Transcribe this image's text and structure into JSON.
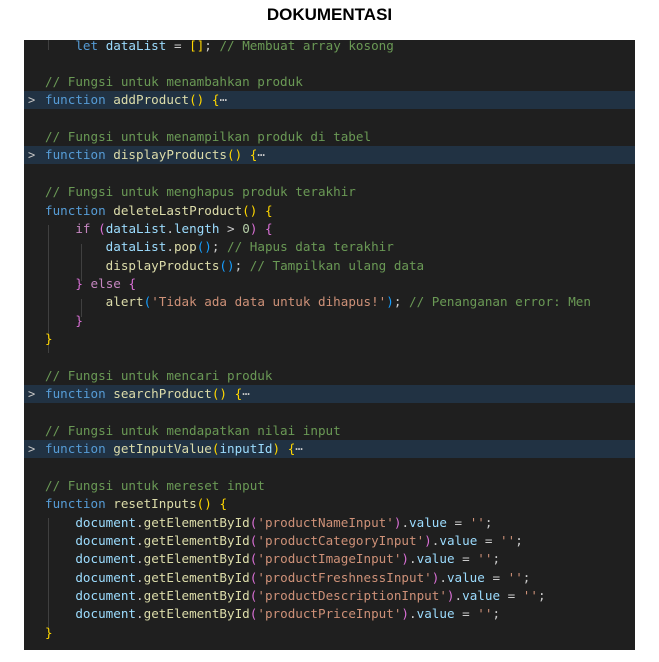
{
  "page": {
    "title": "DOKUMENTASI"
  },
  "code": {
    "l1": {
      "kw": "let",
      "var": "dataList",
      "eq": " = ",
      "arr": "[]",
      "semi": ";",
      "cmt": " // Membuat array kosong"
    },
    "l2": {
      "cmt": "// Fungsi untuk menambahkan produk"
    },
    "l3": {
      "kw": "function",
      "fn": "addProduct",
      "paren": "()",
      "brace": "{",
      "ellipsis": "⋯"
    },
    "l4": {
      "cmt": "// Fungsi untuk menampilkan produk di tabel"
    },
    "l5": {
      "kw": "function",
      "fn": "displayProducts",
      "paren": "()",
      "brace": "{",
      "ellipsis": "⋯"
    },
    "l6": {
      "cmt": "// Fungsi untuk menghapus produk terakhir"
    },
    "l7": {
      "kw": "function",
      "fn": "deleteLastProduct",
      "paren": "()",
      "brace": "{"
    },
    "l8": {
      "kw": "if",
      "p_open": "(",
      "var1": "dataList",
      "dot": ".",
      "var2": "length",
      "op": " > ",
      "num": "0",
      "p_close": ")",
      "brace": "{"
    },
    "l9": {
      "var": "dataList",
      "dot": ".",
      "fn": "pop",
      "paren": "()",
      "semi": ";",
      "cmt": " // Hapus data terakhir"
    },
    "l10": {
      "fn": "displayProducts",
      "paren": "()",
      "semi": ";",
      "cmt": " // Tampilkan ulang data"
    },
    "l11": {
      "brace_close": "}",
      "kw": "else",
      "brace_open": "{"
    },
    "l12": {
      "fn": "alert",
      "p_open": "(",
      "str": "'Tidak ada data untuk dihapus!'",
      "p_close": ")",
      "semi": ";",
      "cmt": " // Penanganan error: Men"
    },
    "l13": {
      "brace": "}"
    },
    "l14": {
      "brace": "}"
    },
    "l15": {
      "cmt": "// Fungsi untuk mencari produk"
    },
    "l16": {
      "kw": "function",
      "fn": "searchProduct",
      "paren": "()",
      "brace": "{",
      "ellipsis": "⋯"
    },
    "l17": {
      "cmt": "// Fungsi untuk mendapatkan nilai input"
    },
    "l18": {
      "kw": "function",
      "fn": "getInputValue",
      "p_open": "(",
      "param": "inputId",
      "p_close": ")",
      "brace": "{",
      "ellipsis": "⋯"
    },
    "l19": {
      "cmt": "// Fungsi untuk mereset input"
    },
    "l20": {
      "kw": "function",
      "fn": "resetInputs",
      "paren": "()",
      "brace": "{"
    },
    "reset_lines": [
      {
        "obj": "document",
        "method": "getElementById",
        "id": "'productNameInput'",
        "prop": "value",
        "str": "''"
      },
      {
        "obj": "document",
        "method": "getElementById",
        "id": "'productCategoryInput'",
        "prop": "value",
        "str": "''"
      },
      {
        "obj": "document",
        "method": "getElementById",
        "id": "'productImageInput'",
        "prop": "value",
        "str": "''"
      },
      {
        "obj": "document",
        "method": "getElementById",
        "id": "'productFreshnessInput'",
        "prop": "value",
        "str": "''"
      },
      {
        "obj": "document",
        "method": "getElementById",
        "id": "'productDescriptionInput'",
        "prop": "value",
        "str": "''"
      },
      {
        "obj": "document",
        "method": "getElementById",
        "id": "'productPriceInput'",
        "prop": "value",
        "str": "''"
      }
    ],
    "l27": {
      "brace": "}"
    }
  },
  "colors": {
    "editor_bg": "#1f1f1f",
    "folded_line_bg": "#213243",
    "keyword": "#569cd6",
    "function": "#dcdcaa",
    "variable": "#9cdcfe",
    "string": "#ce9178",
    "comment": "#6a9955",
    "bracket_level1": "#ffd700",
    "bracket_level2": "#da70d6",
    "bracket_level3": "#179fff"
  }
}
